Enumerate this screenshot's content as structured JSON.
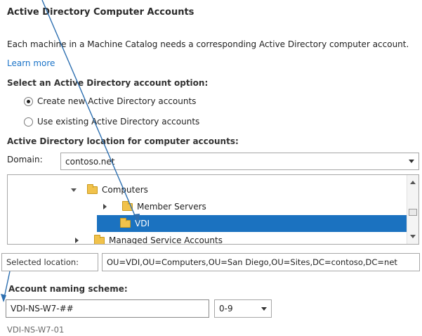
{
  "page": {
    "title": "Active Directory Computer Accounts",
    "description": "Each machine in a Machine Catalog needs a corresponding Active Directory computer account.",
    "learn_more": "Learn more"
  },
  "account_option": {
    "label": "Select an Active Directory account option:",
    "options": [
      {
        "label": "Create new Active Directory accounts",
        "selected": true
      },
      {
        "label": "Use existing Active Directory accounts",
        "selected": false
      }
    ]
  },
  "location": {
    "label": "Active Directory location for computer accounts:",
    "domain_label": "Domain:",
    "domain_value": "contoso.net",
    "tree": [
      {
        "label": "Computers",
        "expanded": true,
        "level": 1
      },
      {
        "label": "Member Servers",
        "expanded": false,
        "level": 2
      },
      {
        "label": "VDI",
        "selected": true,
        "level": 2
      },
      {
        "label": "Managed Service Accounts",
        "expanded": false,
        "level": 0
      }
    ],
    "selected_label": "Selected location:",
    "selected_value": "OU=VDI,OU=Computers,OU=San Diego,OU=Sites,DC=contoso,DC=net"
  },
  "naming": {
    "label": "Account naming scheme:",
    "scheme_value": "VDI-NS-W7-##",
    "format_value": "0-9",
    "preview": "VDI-NS-W7-01"
  },
  "colors": {
    "accent": "#1b72c0",
    "link": "#1a73c8",
    "annotation_arrow": "#2d6fb0"
  }
}
